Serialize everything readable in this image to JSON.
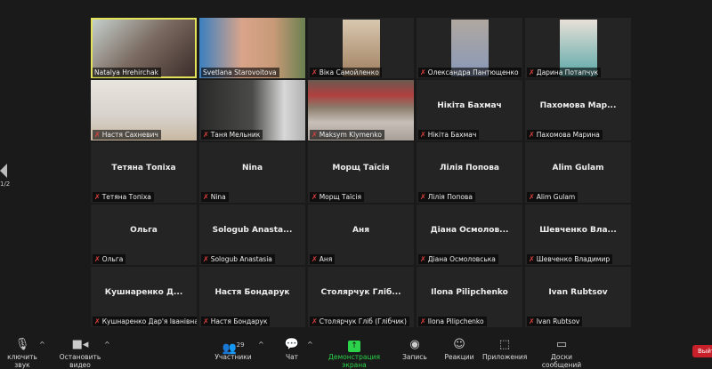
{
  "pager": {
    "page": "1/2"
  },
  "participants": [
    {
      "name": "Natalya Hrehirchak",
      "video": true,
      "muted": false,
      "active": true,
      "style": "v1"
    },
    {
      "name": "Svetlana Starovoitova",
      "video": true,
      "muted": false,
      "style": "v2"
    },
    {
      "name": "Віка Самойленко",
      "video": true,
      "muted": true,
      "style": "v3"
    },
    {
      "name": "Олександра Пантющенко",
      "video": true,
      "muted": true,
      "style": "v3"
    },
    {
      "name": "Дарина Потапчук",
      "video": true,
      "muted": true,
      "style": "v3"
    },
    {
      "name": "Настя Сахневич",
      "video": true,
      "muted": true,
      "style": "v5"
    },
    {
      "name": "Таня Мельник",
      "video": true,
      "muted": true,
      "style": "v6"
    },
    {
      "name": "Maksym Klymenko",
      "video": true,
      "muted": true,
      "style": "v7"
    },
    {
      "name": "Нікіта Бахмач",
      "display": "Нікіта Бахмач",
      "muted": true
    },
    {
      "name": "Пахомова Марина",
      "display": "Пахомова  Мар...",
      "muted": true
    },
    {
      "name": "Тетяна Топіха",
      "display": "Тетяна Топіха",
      "muted": true
    },
    {
      "name": "Nina",
      "display": "Nina",
      "muted": true
    },
    {
      "name": "Морщ Таїсія",
      "display": "Морщ Таїсія",
      "muted": true
    },
    {
      "name": "Лілія Попова",
      "display": "Лілія Попова",
      "muted": true
    },
    {
      "name": "Alim Gulam",
      "display": "Alim Gulam",
      "muted": true
    },
    {
      "name": "Ольга",
      "display": "Ольга",
      "muted": true
    },
    {
      "name": "Sologub Anastasia",
      "display": "Sologub  Anasta...",
      "muted": true
    },
    {
      "name": "Аня",
      "display": "Аня",
      "muted": true
    },
    {
      "name": "Діана Осмоловська",
      "display": "Діана  Осмолов...",
      "muted": true
    },
    {
      "name": "Шевченко Владимир",
      "display": "Шевченко  Вла...",
      "muted": true
    },
    {
      "name": "Кушнаренко Дар'я Іванівна",
      "display": "Кушнаренко  Д...",
      "muted": true
    },
    {
      "name": "Настя Бондарук",
      "display": "Настя Бондарук",
      "muted": true
    },
    {
      "name": "Столярчук Гліб (Глібчик)",
      "display": "Столярчук  Гліб...",
      "muted": true
    },
    {
      "name": "Ilona Pilipchenko",
      "display": "Ilona Pilipchenko",
      "muted": true
    },
    {
      "name": "Ivan Rubtsov",
      "display": "Ivan Rubtsov",
      "muted": true
    }
  ],
  "toolbar": {
    "unmute": "ключить звук",
    "stop_video": "Остановить видео",
    "participants": "Участники",
    "participants_count": "29",
    "chat": "Чат",
    "share": "Демонстрация экрана",
    "record": "Запись",
    "reactions": "Реакции",
    "apps": "Приложения",
    "whiteboards": "Доски сообщений",
    "end": "Выйти"
  },
  "colors": {
    "share": "#2bd24a",
    "active_speaker": "#e3e35a",
    "end": "#c8202a",
    "mute": "#e04040"
  }
}
